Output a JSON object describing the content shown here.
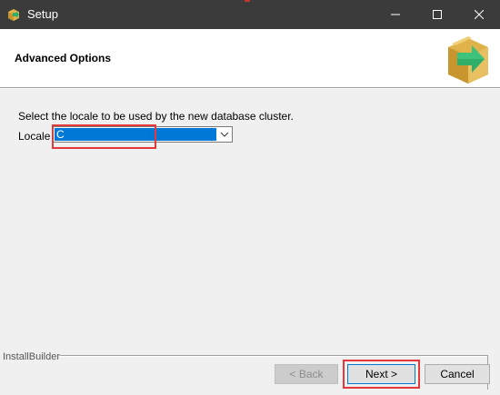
{
  "window": {
    "title": "Setup",
    "controls": [
      "minimize-icon",
      "maximize-icon",
      "close-icon"
    ]
  },
  "header": {
    "title": "Advanced Options",
    "icon": "installer-box-arrow-icon"
  },
  "main": {
    "prompt": "Select the locale to be used by the new database cluster.",
    "locale": {
      "label": "Locale",
      "value": "C"
    }
  },
  "footer": {
    "brand": "InstallBuilder",
    "buttons": {
      "back": "< Back",
      "next": "Next >",
      "cancel": "Cancel"
    }
  },
  "colors": {
    "titlebar": "#3b3b3b",
    "selection": "#0078d7",
    "highlight": "#e5383b",
    "box": "#e0b24a",
    "arrow": "#2fae6a"
  }
}
